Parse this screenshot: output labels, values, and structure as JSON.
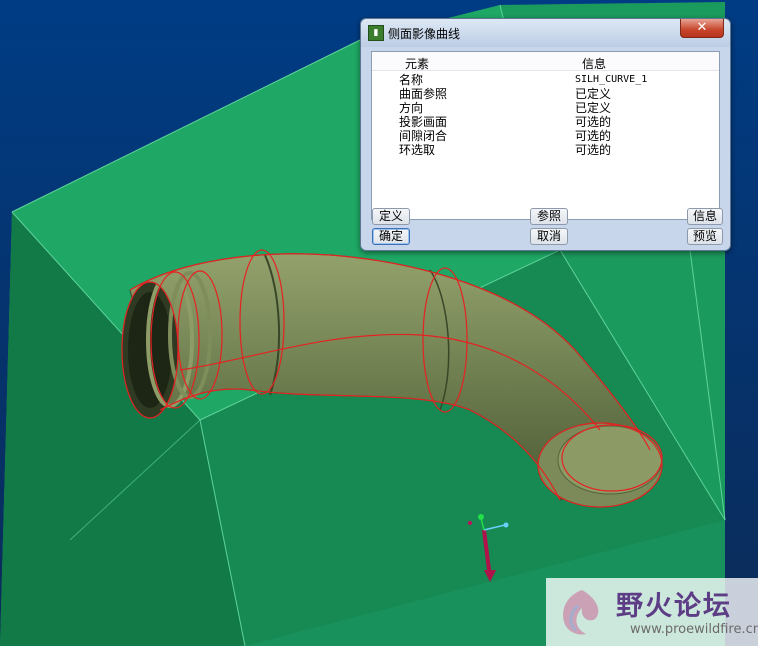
{
  "dialog": {
    "title": "侧面影像曲线",
    "close_glyph": "✕",
    "columns": {
      "element": "元素",
      "info": "信息"
    },
    "rows": [
      {
        "label": "名称",
        "value": "SILH_CURVE_1"
      },
      {
        "label": "曲面参照",
        "value": "已定义"
      },
      {
        "label": "方向",
        "value": "已定义"
      },
      {
        "label": "投影画面",
        "value": "可选的"
      },
      {
        "label": "间隙闭合",
        "value": "可选的"
      },
      {
        "label": "环选取",
        "value": "可选的"
      }
    ],
    "buttons": {
      "define": "定义",
      "reference": "参照",
      "info": "信息",
      "ok": "确定",
      "cancel": "取消",
      "preview": "预览"
    }
  },
  "watermark": {
    "brand": "野火论坛",
    "url": "www.proewildfire.cn"
  },
  "colors": {
    "background_top": "#003a80",
    "background_bottom": "#0c2a55",
    "box_green": "#1e9a5e",
    "pipe_olive": "#6e7e4f",
    "curve_red": "#e02020",
    "dialog_bg": "#c7d6ea"
  }
}
